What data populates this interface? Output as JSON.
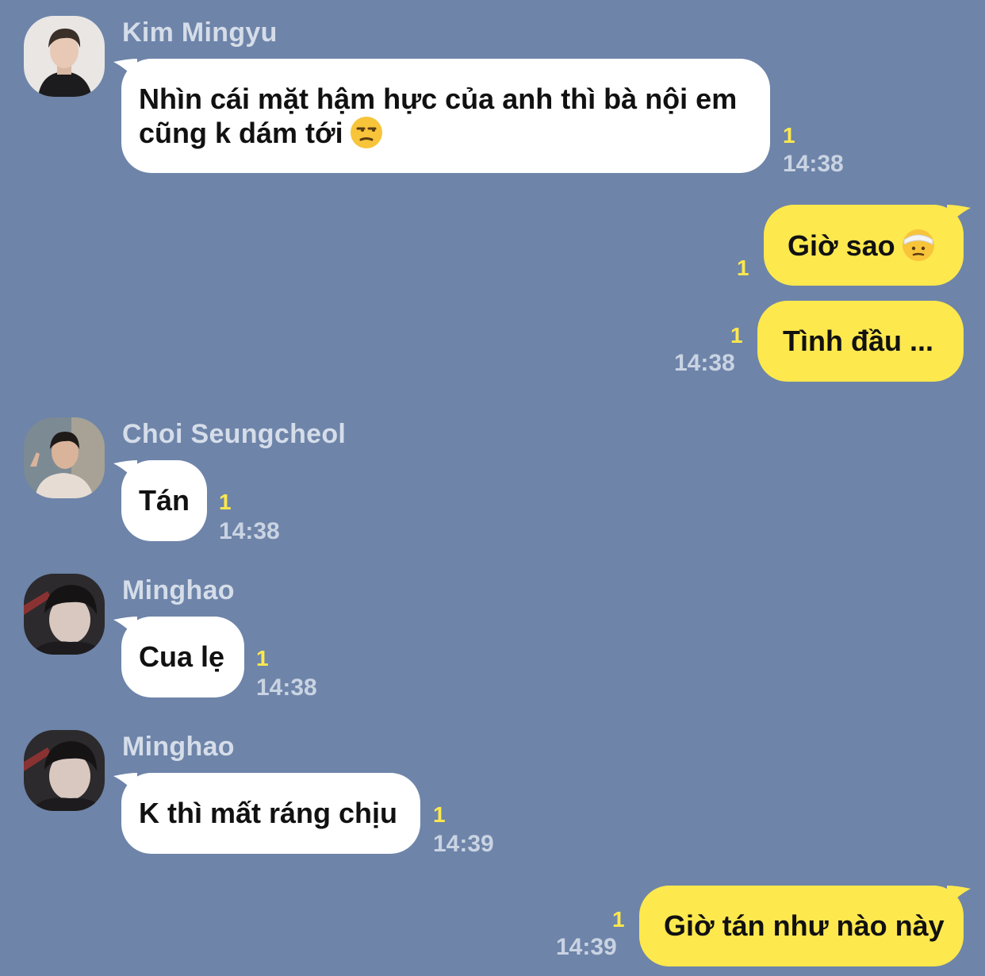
{
  "messages": [
    {
      "sender": "Kim Mingyu",
      "text_line1": "Nhìn cái mặt hậm hực của anh thì bà nội em",
      "text_line2": "cũng k dám tới",
      "emoji": "unamused-face-icon",
      "unread": "1",
      "time": "14:38"
    },
    {
      "sender": "me",
      "text": "Giờ sao",
      "emoji": "head-bandage-face-icon",
      "unread": "1"
    },
    {
      "sender": "me",
      "text": "Tình đầu ...",
      "unread": "1",
      "time": "14:38"
    },
    {
      "sender": "Choi Seungcheol",
      "text": "Tán",
      "unread": "1",
      "time": "14:38"
    },
    {
      "sender": "Minghao",
      "text": "Cua lẹ",
      "unread": "1",
      "time": "14:38"
    },
    {
      "sender": "Minghao",
      "text": "K thì mất ráng chịu",
      "unread": "1",
      "time": "14:39"
    },
    {
      "sender": "me",
      "text": "Giờ tán như nào này",
      "unread": "1",
      "time": "14:39"
    }
  ],
  "colors": {
    "background": "#6e84a9",
    "incoming_bubble": "#ffffff",
    "outgoing_bubble": "#fde84e",
    "unread": "#fde84e",
    "sender_name": "#d5dde9",
    "timestamp": "#c9d3e2"
  }
}
